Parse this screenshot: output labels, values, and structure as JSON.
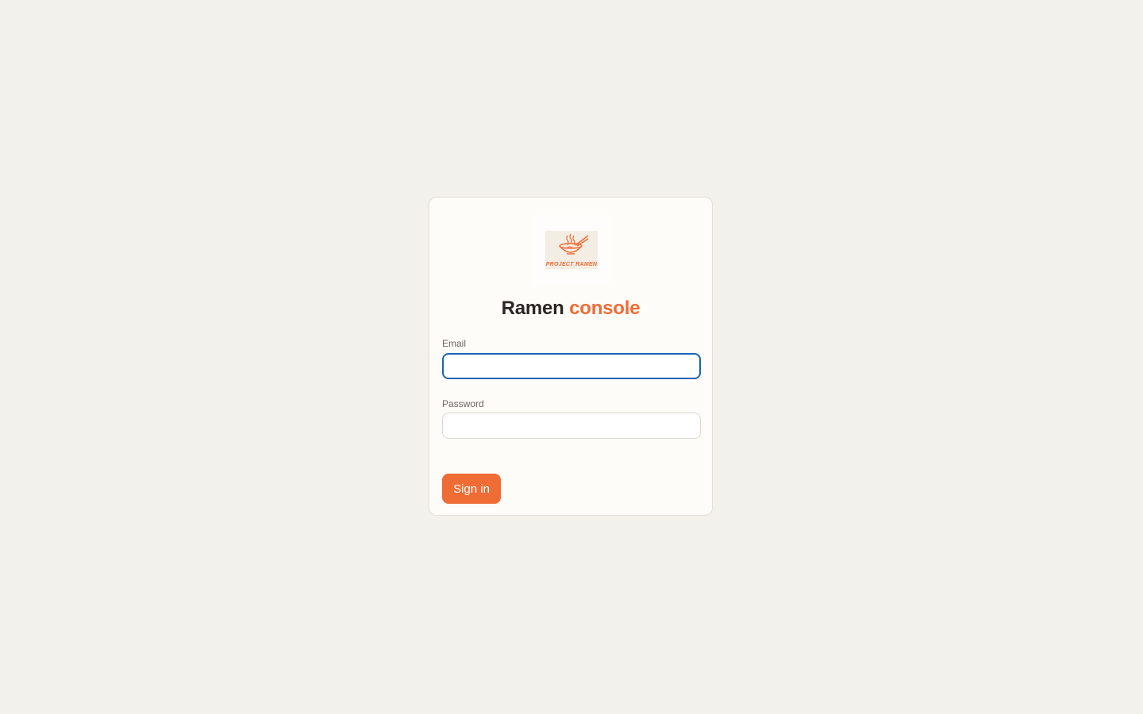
{
  "brand": {
    "logo_text": "PROJECT RAMEN",
    "title_main": "Ramen",
    "title_accent": "console",
    "accent_color": "#ef6c35"
  },
  "form": {
    "email_label": "Email",
    "email_value": "",
    "password_label": "Password",
    "password_value": "",
    "submit_label": "Sign in",
    "focus_color": "#1a63b5"
  }
}
